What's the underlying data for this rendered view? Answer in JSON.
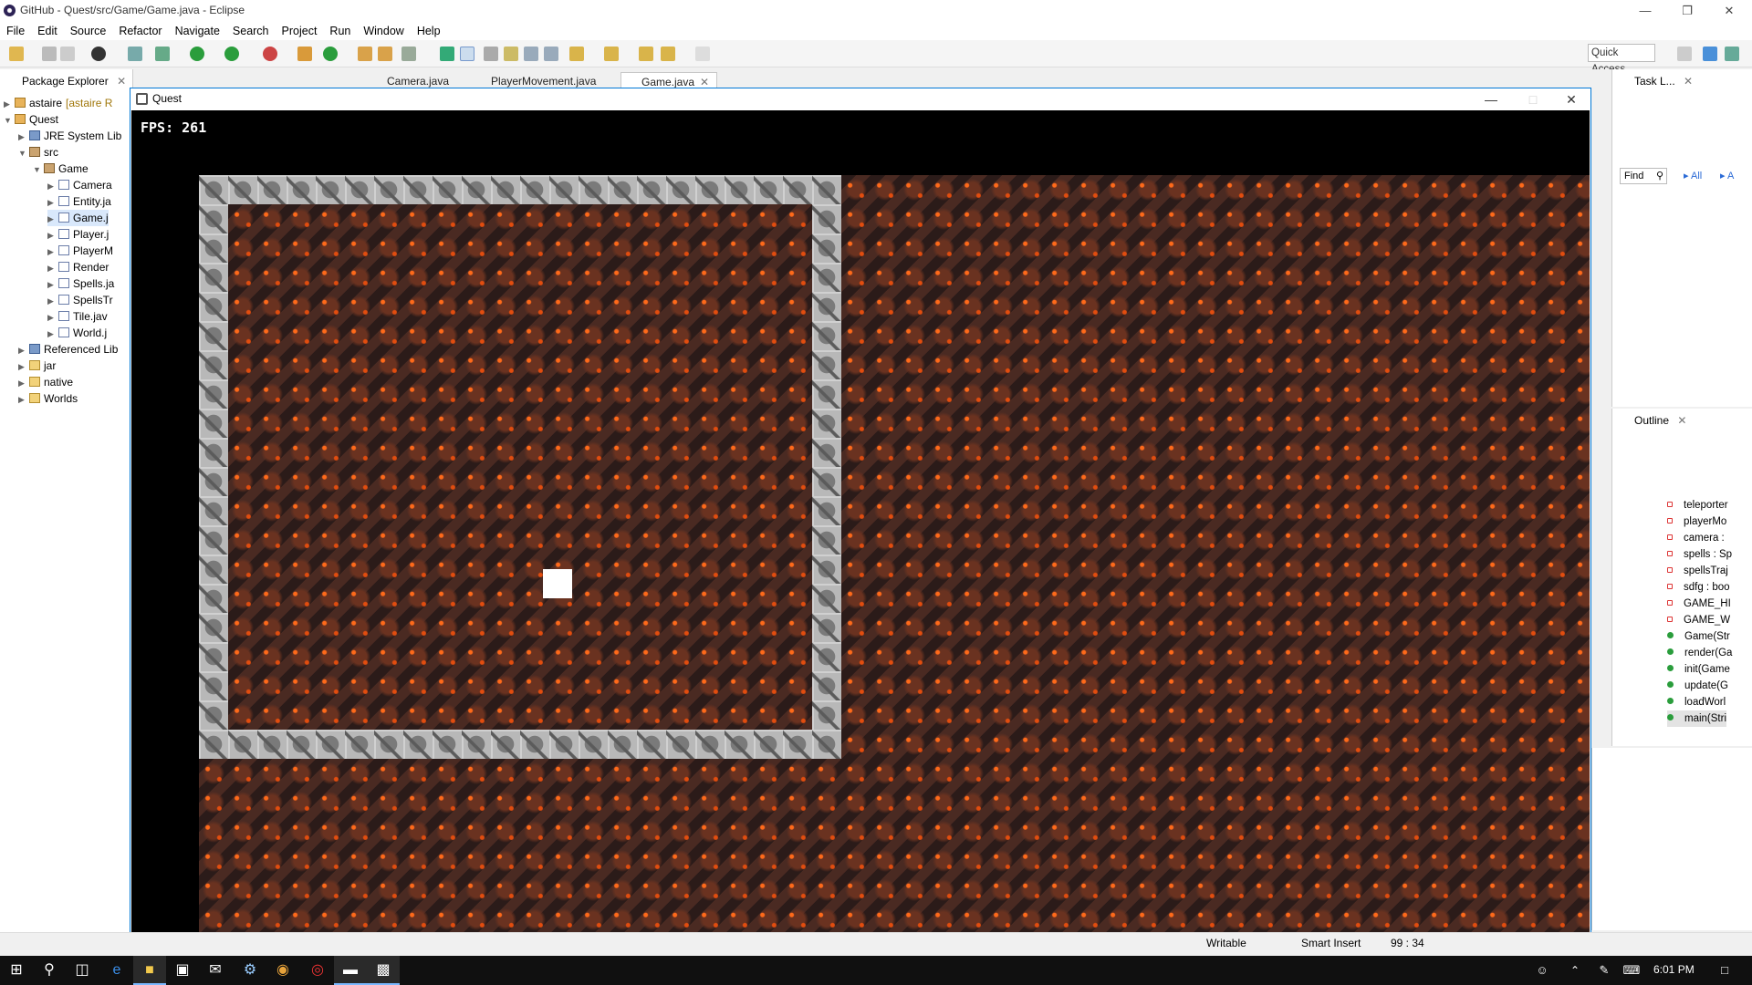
{
  "eclipse": {
    "title": "GitHub - Quest/src/Game/Game.java - Eclipse",
    "menu": [
      "File",
      "Edit",
      "Source",
      "Refactor",
      "Navigate",
      "Search",
      "Project",
      "Run",
      "Window",
      "Help"
    ],
    "quick_access": "Quick Access"
  },
  "package_explorer": {
    "tab": "Package Explorer",
    "tree": [
      {
        "label": "astaire",
        "suffix": "[astaire R",
        "depth": 0,
        "icon": "project",
        "expanded": false
      },
      {
        "label": "Quest",
        "depth": 0,
        "icon": "project",
        "expanded": true
      },
      {
        "label": "JRE System Lib",
        "depth": 1,
        "icon": "library",
        "expanded": false
      },
      {
        "label": "src",
        "depth": 1,
        "icon": "package-root",
        "expanded": true
      },
      {
        "label": "Game",
        "depth": 2,
        "icon": "package",
        "expanded": true
      },
      {
        "label": "Camera",
        "depth": 3,
        "icon": "java-file",
        "expanded": false
      },
      {
        "label": "Entity.ja",
        "depth": 3,
        "icon": "java-file",
        "expanded": false
      },
      {
        "label": "Game.j",
        "depth": 3,
        "icon": "java-file",
        "expanded": false,
        "selected": true
      },
      {
        "label": "Player.j",
        "depth": 3,
        "icon": "java-file",
        "expanded": false
      },
      {
        "label": "PlayerM",
        "depth": 3,
        "icon": "java-file",
        "expanded": false
      },
      {
        "label": "Render",
        "depth": 3,
        "icon": "java-file",
        "expanded": false
      },
      {
        "label": "Spells.ja",
        "depth": 3,
        "icon": "java-file",
        "expanded": false
      },
      {
        "label": "SpellsTr",
        "depth": 3,
        "icon": "java-file",
        "expanded": false
      },
      {
        "label": "Tile.jav",
        "depth": 3,
        "icon": "java-file",
        "expanded": false
      },
      {
        "label": "World.j",
        "depth": 3,
        "icon": "java-file",
        "expanded": false
      },
      {
        "label": "Referenced Lib",
        "depth": 1,
        "icon": "library",
        "expanded": false
      },
      {
        "label": "jar",
        "depth": 1,
        "icon": "folder",
        "expanded": false
      },
      {
        "label": "native",
        "depth": 1,
        "icon": "folder",
        "expanded": false
      },
      {
        "label": "Worlds",
        "depth": 1,
        "icon": "folder",
        "expanded": false
      }
    ]
  },
  "editor_tabs": [
    {
      "label": "Camera.java",
      "active": false
    },
    {
      "label": "PlayerMovement.java",
      "active": false
    },
    {
      "label": "Game.java",
      "active": true
    }
  ],
  "quest_window": {
    "title": "Quest",
    "fps_text": "FPS: 261"
  },
  "task_list": {
    "tab": "Task L...",
    "find_placeholder": "Find",
    "filter_all": "All",
    "filter_a": "A"
  },
  "outline": {
    "tab": "Outline",
    "items": [
      {
        "label": "teleporter",
        "kind": "private"
      },
      {
        "label": "playerMo",
        "kind": "private"
      },
      {
        "label": "camera :",
        "kind": "private"
      },
      {
        "label": "spells : Sp",
        "kind": "private"
      },
      {
        "label": "spellsTraj",
        "kind": "private"
      },
      {
        "label": "sdfg : boo",
        "kind": "private"
      },
      {
        "label": "GAME_HI",
        "kind": "static-final"
      },
      {
        "label": "GAME_W",
        "kind": "static-final"
      },
      {
        "label": "Game(Str",
        "kind": "constructor"
      },
      {
        "label": "render(Ga",
        "kind": "public"
      },
      {
        "label": "init(Game",
        "kind": "public"
      },
      {
        "label": "update(G",
        "kind": "public"
      },
      {
        "label": "loadWorl",
        "kind": "public"
      },
      {
        "label": "main(Stri",
        "kind": "public-static",
        "selected": true
      }
    ]
  },
  "status_bar": {
    "writable": "Writable",
    "insert_mode": "Smart Insert",
    "position": "99 : 34"
  },
  "taskbar": {
    "clock": "6:01 PM"
  }
}
